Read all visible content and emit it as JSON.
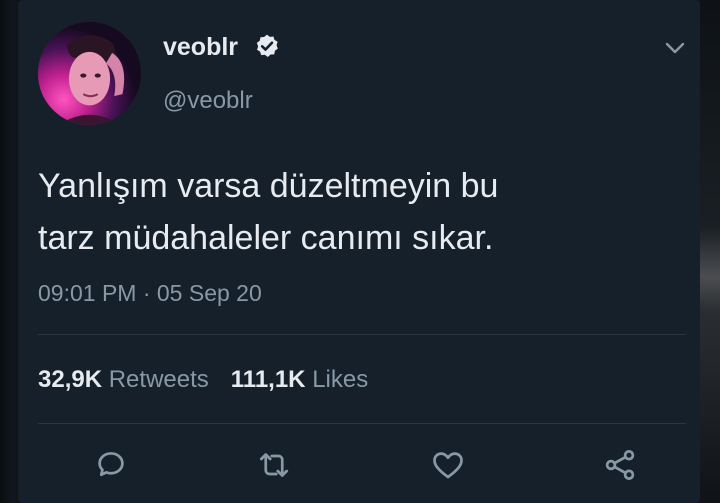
{
  "tweet": {
    "display_name": "veoblr",
    "handle": "@veoblr",
    "text_line1": "Yanlışım varsa düzeltmeyin bu",
    "text_line2": "tarz müdahaleler canımı sıkar.",
    "timestamp": "09:01 PM · 05 Sep 20"
  },
  "stats": {
    "retweets_count": "32,9K",
    "retweets_label": "Retweets",
    "likes_count": "111,1K",
    "likes_label": "Likes"
  },
  "icons": {
    "verified": "verified-badge-icon",
    "more": "chevron-down-icon",
    "reply": "reply-icon",
    "retweet": "retweet-icon",
    "like": "heart-icon",
    "share": "share-icon"
  },
  "colors": {
    "background": "#15202b",
    "text_primary": "#e7ebef",
    "text_secondary": "#8899a6",
    "divider": "#2a3641"
  }
}
